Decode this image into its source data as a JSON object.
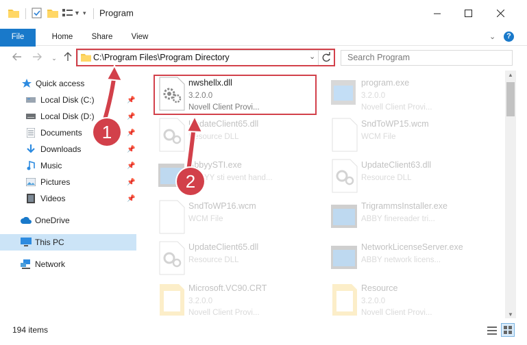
{
  "window": {
    "title": "Program",
    "minimize_icon": "minimize-icon",
    "maximize_icon": "maximize-icon",
    "close_icon": "close-icon"
  },
  "ribbon": {
    "tabs": [
      {
        "label": "File"
      },
      {
        "label": "Home"
      },
      {
        "label": "Share"
      },
      {
        "label": "View"
      }
    ]
  },
  "address": {
    "path": "C:\\Program Files\\Program Directory"
  },
  "search": {
    "placeholder": "Search Program"
  },
  "sidebar": {
    "items": [
      {
        "label": "Quick access",
        "icon": "star-icon",
        "pinned": false
      },
      {
        "label": "Local Disk (C:)",
        "icon": "drive-icon",
        "pinned": true
      },
      {
        "label": "Local Disk (D:)",
        "icon": "drive-icon",
        "pinned": true
      },
      {
        "label": "Documents",
        "icon": "documents-icon",
        "pinned": true
      },
      {
        "label": "Downloads",
        "icon": "download-icon",
        "pinned": true
      },
      {
        "label": "Music",
        "icon": "music-icon",
        "pinned": true
      },
      {
        "label": "Pictures",
        "icon": "pictures-icon",
        "pinned": true
      },
      {
        "label": "Videos",
        "icon": "videos-icon",
        "pinned": true
      },
      {
        "label": "OneDrive",
        "icon": "cloud-icon",
        "pinned": false
      },
      {
        "label": "This PC",
        "icon": "monitor-icon",
        "pinned": false
      },
      {
        "label": "Network",
        "icon": "network-icon",
        "pinned": false
      }
    ]
  },
  "files": [
    {
      "name": "nwshellx.dll",
      "line2": "3.2.0.0",
      "line3": "Novell Client Provi...",
      "icon": "dll-gear-icon"
    },
    {
      "name": "program.exe",
      "line2": "3.2.0.0",
      "line3": "Novell Client Provi...",
      "icon": "exe-icon"
    },
    {
      "name": "UpdateClient65.dll",
      "line2": "Resource DLL",
      "line3": "",
      "icon": "dll-gear-icon"
    },
    {
      "name": "SndToWP15.wcm",
      "line2": "WCM File",
      "line3": "",
      "icon": "blank-file-icon"
    },
    {
      "name": "AbbyySTI.exe",
      "line2": "ABBYY sti event hand...",
      "line3": "",
      "icon": "exe-icon"
    },
    {
      "name": "UpdateClient63.dll",
      "line2": "Resource DLL",
      "line3": "",
      "icon": "dll-gear-icon"
    },
    {
      "name": "SndToWP16.wcm",
      "line2": "WCM File",
      "line3": "",
      "icon": "blank-file-icon"
    },
    {
      "name": "TrigrammsInstaller.exe",
      "line2": "ABBY finereader tri...",
      "line3": "",
      "icon": "exe-icon"
    },
    {
      "name": "UpdateClient65.dll",
      "line2": "Resource DLL",
      "line3": "",
      "icon": "dll-gear-icon"
    },
    {
      "name": "NetworkLicenseServer.exe",
      "line2": "ABBY network licens...",
      "line3": "",
      "icon": "exe-icon"
    },
    {
      "name": "Microsoft.VC90.CRT",
      "line2": "3.2.0.0",
      "line3": "Novell Client Provi...",
      "icon": "folder-icon"
    },
    {
      "name": "Resource",
      "line2": "3.2.0.0",
      "line3": "Novell Client Provi...",
      "icon": "folder-icon"
    }
  ],
  "status": {
    "item_count": "194 items"
  },
  "callouts": {
    "one": "1",
    "two": "2"
  },
  "colors": {
    "accent": "#1979ca",
    "highlight": "#d2404a",
    "selected": "#cce4f7"
  }
}
